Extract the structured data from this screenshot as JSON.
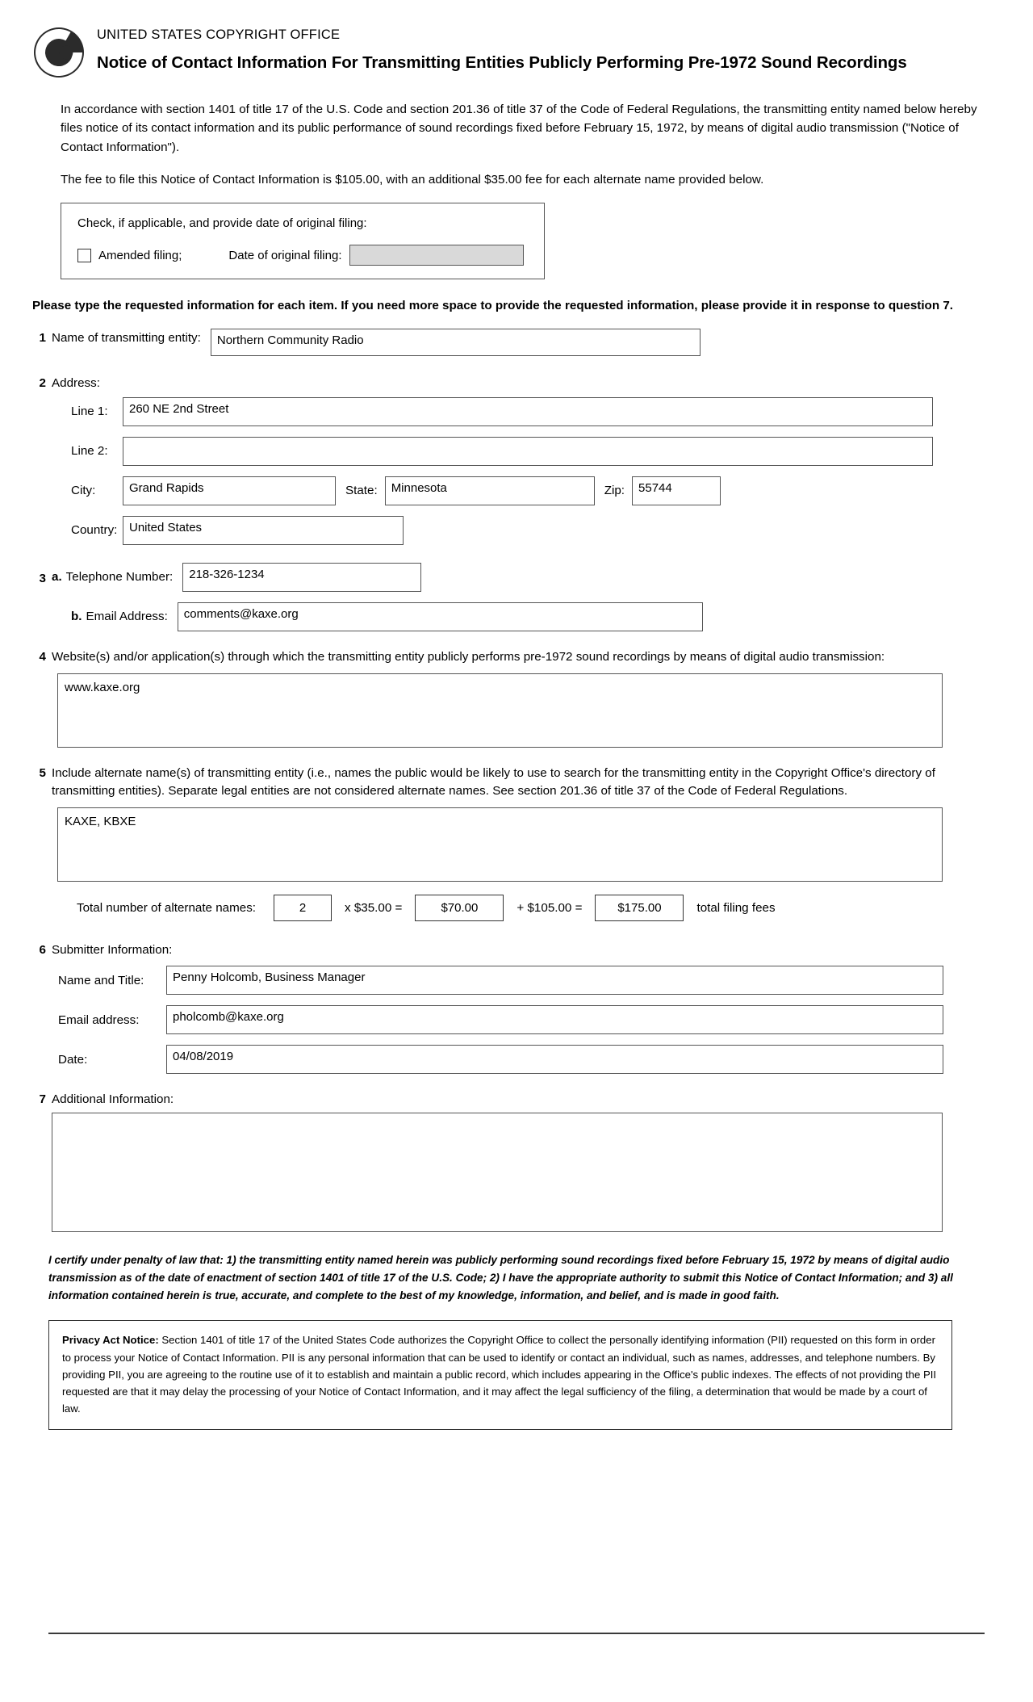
{
  "header": {
    "logo_icon": "copyright-c-logo",
    "office_name": "UNITED STATES COPYRIGHT OFFICE",
    "title": "Notice of Contact Information For Transmitting Entities Publicly Performing Pre-1972 Sound Recordings"
  },
  "intro": {
    "paragraph_1": "In accordance with section 1401 of title 17 of the U.S. Code and section 201.36 of title 37 of the Code of Federal Regulations, the transmitting entity named below hereby files notice of its contact information and its public performance of sound recordings fixed before February 15, 1972, by means of digital audio transmission (\"Notice of Contact Information\").",
    "paragraph_2": "The fee to file this Notice of Contact Information is $105.00, with an additional $35.00 fee for each alternate name provided below."
  },
  "amended": {
    "prompt": "Check, if applicable, and provide date of original filing:",
    "checkbox_label": "Amended filing;",
    "checkbox_checked": false,
    "date_label": "Date of original filing:",
    "date_value": "",
    "date_field_fill": "#d9d9d9"
  },
  "instruction": "Please type the requested information for each item.  If you need more space to provide the requested information, please provide it in response to question 7.",
  "item1": {
    "number": "1",
    "label": "Name of transmitting entity:",
    "value": "Northern Community Radio"
  },
  "item2": {
    "number": "2",
    "label": "Address:",
    "line1_label": "Line 1:",
    "line1_value": "260 NE 2nd Street",
    "line2_label": "Line 2:",
    "line2_value": "",
    "city_label": "City:",
    "city_value": "Grand Rapids",
    "state_label": "State:",
    "state_value": "Minnesota",
    "zip_label": "Zip:",
    "zip_value": "55744",
    "country_label": "Country:",
    "country_value": "United States"
  },
  "item3": {
    "number": "3",
    "a_marker": "a.",
    "phone_label": "Telephone Number:",
    "phone_value": "218-326-1234",
    "b_marker": "b.",
    "email_label": "Email Address:",
    "email_value": "comments@kaxe.org"
  },
  "item4": {
    "number": "4",
    "label": "Website(s) and/or application(s) through which the transmitting entity publicly performs pre-1972 sound recordings by means of digital audio transmission:",
    "value": "www.kaxe.org"
  },
  "item5": {
    "number": "5",
    "label": "Include alternate name(s) of transmitting entity (i.e., names the public would be likely to use to search for the transmitting entity in the Copyright Office's directory of transmitting entities). Separate legal entities are not considered alternate names. See section 201.36 of title 37 of the Code of Federal Regulations.",
    "value": "KAXE, KBXE",
    "fee_label": "Total number of alternate names:",
    "count": "2",
    "multiplier_text": "x $35.00 =",
    "subtotal": "$70.00",
    "base_fee_text": "+ $105.00 =",
    "total": "$175.00",
    "total_suffix": "total filing fees"
  },
  "item6": {
    "number": "6",
    "label": "Submitter Information:",
    "name_label": "Name and Title:",
    "name_value": "Penny Holcomb, Business Manager",
    "email_label": "Email address:",
    "email_value": "pholcomb@kaxe.org",
    "date_label": "Date:",
    "date_value": "04/08/2019"
  },
  "item7": {
    "number": "7",
    "label": "Additional Information:",
    "value": ""
  },
  "certification": "I certify under penalty of law that: 1) the transmitting entity named herein was publicly performing sound recordings fixed before February 15, 1972 by means of digital audio transmission as of the date of enactment of section 1401 of title 17 of the U.S. Code; 2) I have the appropriate authority to submit this Notice of Contact Information; and 3) all information contained herein is true, accurate, and complete to the best of my knowledge, information, and belief, and is made in good faith.",
  "privacy": {
    "heading": "Privacy Act Notice:",
    "body": " Section 1401 of title 17 of the United States Code authorizes the Copyright Office to collect the personally identifying information (PII) requested on this form in order to process your Notice of Contact Information. PII is any personal information that can be used to identify or contact an individual, such as names, addresses, and telephone numbers. By providing PII, you are agreeing to the routine use of it to establish and maintain a public record, which includes appearing in the Office's public indexes. The effects of not providing the PII requested are that it may delay the processing of your Notice of Contact Information, and it may affect the legal sufficiency of the filing, a determination that would be made by a court of law."
  }
}
